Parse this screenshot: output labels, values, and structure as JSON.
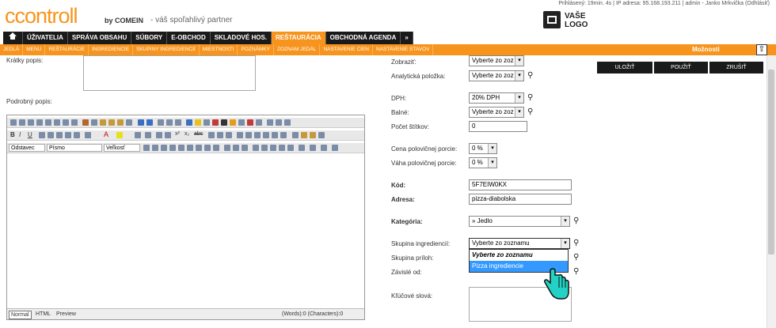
{
  "header": {
    "logo_text": "ccontroll",
    "by_text": "by COMEIN",
    "tagline": "- váš spoľahlivý partner",
    "session_info": "Prihlásený: 19min. 4s  |  IP adresa: 95.168.193.211  |  admin - Janko Mrkvička (Odhlásiť)",
    "your_logo": "VAŠE LOGO",
    "your_logo_line1": "VAŠE",
    "your_logo_line2": "LOGO"
  },
  "nav": {
    "items": [
      "ÚŽIVATELIA",
      "SPRÁVA OBSAHU",
      "SÚBORY",
      "E-OBCHOD",
      "SKLADOVÉ HOS.",
      "REŠTAURÁCIA",
      "OBCHODNÁ AGENDA",
      "»"
    ],
    "active": "REŠTAURÁCIA"
  },
  "subnav": {
    "items": [
      "JEDLÁ",
      "MENU",
      "REŠTAURÁCIE",
      "INGREDIENCIE",
      "SKUPINY INGREDIENCIÍ",
      "MIESTNOSTI",
      "POZNÁMKY",
      "ZOZNAM JEDÁL",
      "NASTAVENIE CIEN",
      "NASTAVENIE STAVOV"
    ],
    "options_label": "Možnosti"
  },
  "actions": {
    "save": "ULOŽIŤ",
    "apply": "POUŽIŤ",
    "cancel": "ZRUŠIŤ"
  },
  "left": {
    "short_desc_label": "Krátky popis:",
    "detail_desc_label": "Podrobný popis:"
  },
  "editor": {
    "format_select": "Odstavec",
    "font_select": "Písmo",
    "size_select": "Veľkosť",
    "mode_normal": "Normal",
    "mode_html": "HTML",
    "mode_preview": "Preview",
    "counter": "(Words):0 (Characters):0"
  },
  "form": {
    "zobrazit": {
      "label": "Zobraziť:",
      "value": "Vyberte zo zoz"
    },
    "analyticka": {
      "label": "Analytická položka:",
      "value": "Vyberte zo zoz"
    },
    "dph": {
      "label": "DPH:",
      "value": "20% DPH"
    },
    "balne": {
      "label": "Balné:",
      "value": "Vyberte zo zoz"
    },
    "pocet": {
      "label": "Počet štítkov:",
      "value": "0"
    },
    "cena_pol": {
      "label": "Cena polovičnej porcie:",
      "value": "0 %"
    },
    "vaha_pol": {
      "label": "Váha polovičnej porcie:",
      "value": "0 %"
    },
    "kod": {
      "label": "Kód:",
      "value": "5F7EIW0KX"
    },
    "adresa": {
      "label": "Adresa:",
      "value": "pizza-diabolska"
    },
    "kategoria": {
      "label": "Kategória:",
      "value": "» Jedlo"
    },
    "skupina_ingr": {
      "label": "Skupina ingrediencií:",
      "value": "Vyberte zo zoznamu"
    },
    "skupina_prilog": {
      "label": "Skupina príloh:"
    },
    "zavisle": {
      "label": "Závislé od:"
    },
    "klucove": {
      "label": "Kľúčové slová:"
    }
  },
  "dropdown": {
    "options": [
      "Vyberte zo zoznamu",
      "Pizza ingrediencie"
    ],
    "highlighted": "Pizza ingrediencie"
  }
}
